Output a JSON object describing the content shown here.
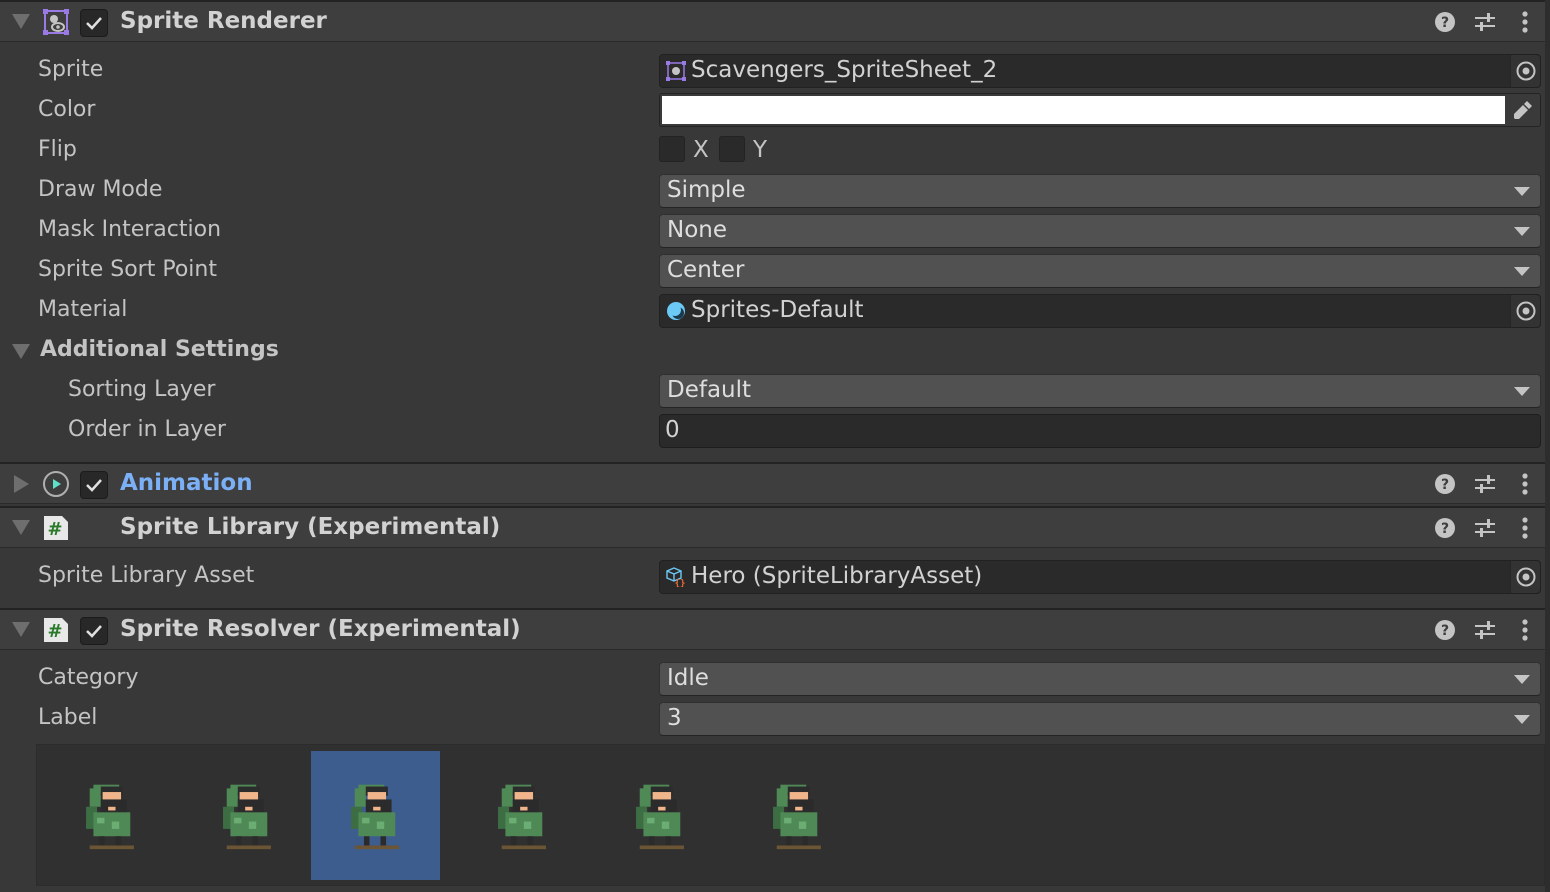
{
  "components": {
    "sprite_renderer": {
      "title": "Sprite Renderer",
      "enabled": true,
      "expanded": true,
      "icon": "sprite-renderer-icon",
      "fields": {
        "sprite": {
          "label": "Sprite",
          "value": "Scavengers_SpriteSheet_2",
          "icon": "sprite-asset-icon"
        },
        "color": {
          "label": "Color",
          "value": "#FFFFFF"
        },
        "flip": {
          "label": "Flip",
          "x_label": "X",
          "y_label": "Y",
          "x_checked": false,
          "y_checked": false
        },
        "draw_mode": {
          "label": "Draw Mode",
          "value": "Simple"
        },
        "mask_interaction": {
          "label": "Mask Interaction",
          "value": "None"
        },
        "sprite_sort_point": {
          "label": "Sprite Sort Point",
          "value": "Center"
        },
        "material": {
          "label": "Material",
          "value": "Sprites-Default",
          "icon": "material-icon"
        }
      },
      "additional_settings": {
        "label": "Additional Settings",
        "expanded": true,
        "sorting_layer": {
          "label": "Sorting Layer",
          "value": "Default"
        },
        "order_in_layer": {
          "label": "Order in Layer",
          "value": "0"
        }
      }
    },
    "animation": {
      "title": "Animation",
      "enabled": true,
      "expanded": false,
      "icon": "animation-icon",
      "title_color": "#7BB0F7"
    },
    "sprite_library": {
      "title": "Sprite Library (Experimental)",
      "expanded": true,
      "icon": "script-icon",
      "fields": {
        "asset": {
          "label": "Sprite Library Asset",
          "value": "Hero (SpriteLibraryAsset)",
          "icon": "sprite-library-asset-icon"
        }
      }
    },
    "sprite_resolver": {
      "title": "Sprite Resolver (Experimental)",
      "enabled": true,
      "expanded": true,
      "icon": "script-icon",
      "fields": {
        "category": {
          "label": "Category",
          "value": "Idle"
        },
        "label": {
          "label": "Label",
          "value": "3"
        }
      },
      "sprite_options": {
        "count": 6,
        "selected_index": 2,
        "selected_color": "#3C5D8E",
        "items": [
          "hero-idle-1",
          "hero-idle-2",
          "hero-idle-3",
          "hero-idle-4",
          "hero-idle-5",
          "hero-idle-6"
        ]
      }
    }
  },
  "header_icons": [
    "help-icon",
    "preset-icon",
    "more-menu-icon"
  ]
}
